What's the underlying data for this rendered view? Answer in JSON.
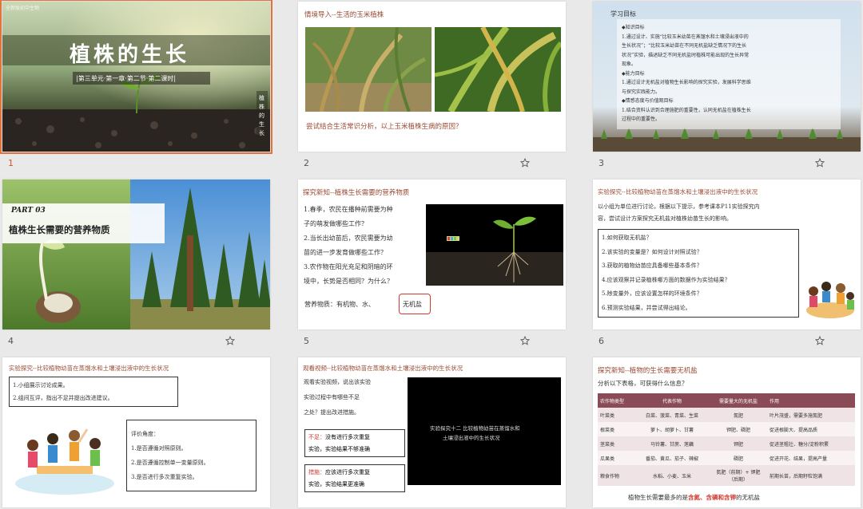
{
  "slides": [
    {
      "num": "1",
      "title": "植株的生长",
      "subtitle": "|第三单元·第一章·第二节·第二课时|",
      "side_text": "植株的生长",
      "corner_text": "全新版初中生物"
    },
    {
      "num": "2",
      "heading": "情境导入--生活的玉米植株",
      "question": "尝试结合生活常识分析，以上玉米植株生病的原因？"
    },
    {
      "num": "3",
      "heading": "学习目标",
      "lines": [
        "◆知识目标",
        "1.通过设计、实施“比较玉米幼苗在蒸馏水和土壤浸出液中的",
        "生长状况”；“比较玉米幼苗在不同无机盐缺乏情况下的生长",
        "状况”实验，描述缺乏不同无机盐时植株可能出现的生长异常",
        "现象。",
        "◆能力目标",
        "1.通过设计无机盐对植物生长影响的探究实验，发展科学思维",
        "与探究实践能力。",
        "◆情感态度与价值观目标",
        "1.结合资料认识到合理施肥的重要性，认同无机盐在植株生长",
        "过程中的重要性。"
      ]
    },
    {
      "num": "4",
      "part": "PART 03",
      "title": "植株生长需要的营养物质"
    },
    {
      "num": "5",
      "heading": "探究新知--植株生长需要的营养物质",
      "lines": [
        "1.春季，农民在播种前需要为种",
        "子的萌发做哪些工作？",
        "2.当长出幼苗后，农民需要为幼",
        "苗的进一步发育做哪些工作？",
        "3.农作物在阳光充足和阴暗的环",
        "境中，长势是否相同？为什么？"
      ],
      "nutrients_prefix": "营养物质：有机物、水、",
      "nutrients_highlight": "无机盐"
    },
    {
      "num": "6",
      "heading": "实验探究--比较植物幼苗在蒸馏水和土壤浸出液中的生长状况",
      "intro": [
        "以小组为单位进行讨论，根据以下提示，参考课本P11实验探究内",
        "容，尝试设计方案探究无机盐对植株幼苗生长的影响。"
      ],
      "questions": [
        "1.如何获取无机盐？",
        "2.该实验的变量是？如何设计对照试验？",
        "3.获取的植物幼苗应具备哪些基本条件？",
        "4.应该观察并记录植株哪方面的数据作为实验结果？",
        "5.除变量外，应该设置怎样的环境条件？",
        "6.预测实验结果，并尝试得出结论。"
      ]
    },
    {
      "num": "7",
      "heading": "实验探究--比较植物幼苗在蒸馏水和土壤浸出液中的生长状况",
      "tasks": [
        "1.小组展示讨论成果。",
        "2.组间互评，指出不足并提出改进建议。"
      ],
      "eval_title": "评价角度：",
      "evals": [
        "1.是否遵循对照原则。",
        "2.是否遵循控制单一变量原则。",
        "3.是否进行多次重复实验。"
      ]
    },
    {
      "num": "8",
      "heading": "观看视频--比较植物幼苗在蒸馏水和土壤浸出液中的生长状况",
      "lines": [
        "观看实验视频，说出该实验",
        "实验过程中有哪些不足",
        "之处？提出改进措施。"
      ],
      "shortage_label": "不足：",
      "shortage": [
        "没有进行多次重复",
        "实验，实验结果不够准确"
      ],
      "fix_label": "措施：",
      "fix": [
        "应该进行多次重复",
        "实验，实验结果更准确"
      ],
      "video_text": [
        "实验探究十二 比较植物幼苗在蒸馏水和",
        "土壤浸出液中的生长状况"
      ]
    },
    {
      "num": "9",
      "heading": "探究新知--植物的生长需要无机盐",
      "sub": "分析以下表格，可获得什么信息？",
      "table_head": [
        "农作物类型",
        "代表作物",
        "需要量大的无机盐",
        "作用"
      ],
      "table_rows": [
        [
          "叶菜类",
          "白菜、菠菜、青菜、生菜",
          "氮肥",
          "叶片茂盛，需要多施氮肥"
        ],
        [
          "根菜类",
          "萝卜、胡萝卜、甘薯",
          "钾肥、磷肥",
          "促进根膨大、提高品质"
        ],
        [
          "茎菜类",
          "马铃薯、甘蔗、莲藕",
          "钾肥",
          "促进茎粗壮、糖分/淀粉积累"
        ],
        [
          "瓜果类",
          "番茄、黄瓜、茄子、辣椒",
          "磷肥",
          "促进开花、结果，提高产量"
        ],
        [
          "粮食作物",
          "水稻、小麦、玉米",
          "氮肥（前期）+ 钾肥（后期）",
          "前期长苗，后期籽粒饱满"
        ]
      ],
      "conclusion_prefix": "植物生长需要最多的是",
      "conclusion_highlight": "含氮、含磷和含钾",
      "conclusion_suffix": "的无机盐"
    }
  ],
  "colors": {
    "accent": "#e0743a",
    "title": "#9a4a32",
    "table_header": "#8a4b57",
    "highlight": "#d23a2e"
  }
}
